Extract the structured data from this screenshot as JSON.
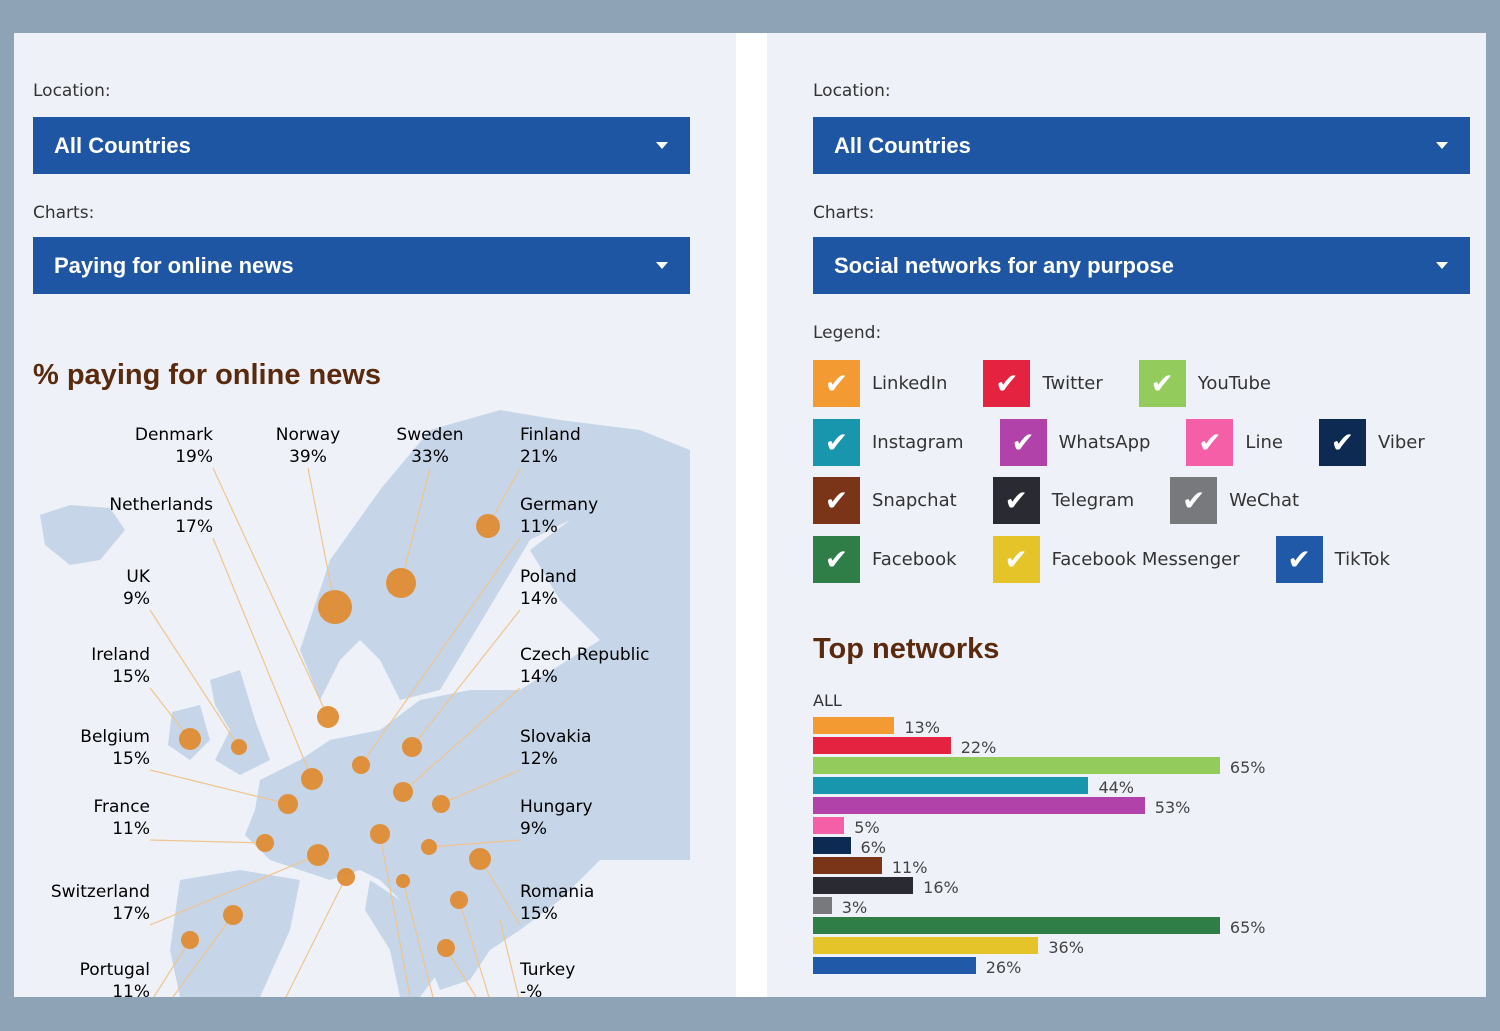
{
  "left": {
    "location_label": "Location:",
    "location_value": "All Countries",
    "charts_label": "Charts:",
    "charts_value": "Paying for online news",
    "title": "% paying for online news",
    "countries": [
      {
        "name": "Denmark",
        "value": "19%"
      },
      {
        "name": "Norway",
        "value": "39%"
      },
      {
        "name": "Sweden",
        "value": "33%"
      },
      {
        "name": "Finland",
        "value": "21%"
      },
      {
        "name": "Netherlands",
        "value": "17%"
      },
      {
        "name": "Germany",
        "value": "11%"
      },
      {
        "name": "UK",
        "value": "9%"
      },
      {
        "name": "Poland",
        "value": "14%"
      },
      {
        "name": "Ireland",
        "value": "15%"
      },
      {
        "name": "Czech Republic",
        "value": "14%"
      },
      {
        "name": "Belgium",
        "value": "15%"
      },
      {
        "name": "Slovakia",
        "value": "12%"
      },
      {
        "name": "France",
        "value": "11%"
      },
      {
        "name": "Hungary",
        "value": "9%"
      },
      {
        "name": "Switzerland",
        "value": "17%"
      },
      {
        "name": "Romania",
        "value": "15%"
      },
      {
        "name": "Portugal",
        "value": "11%"
      },
      {
        "name": "Turkey",
        "value": "-%"
      }
    ],
    "marker_color": "#e08a2e",
    "map_color": "#c6d5e8"
  },
  "right": {
    "location_label": "Location:",
    "location_value": "All Countries",
    "charts_label": "Charts:",
    "charts_value": "Social networks for any purpose",
    "legend_label": "Legend:",
    "legend": [
      {
        "name": "LinkedIn",
        "color": "#f39a32",
        "checked": true
      },
      {
        "name": "Twitter",
        "color": "#e3233f",
        "checked": true
      },
      {
        "name": "YouTube",
        "color": "#94cb5d",
        "checked": true
      },
      {
        "name": "Instagram",
        "color": "#1796ad",
        "checked": true
      },
      {
        "name": "WhatsApp",
        "color": "#b042a9",
        "checked": true
      },
      {
        "name": "Line",
        "color": "#f45fa8",
        "checked": true
      },
      {
        "name": "Viber",
        "color": "#0d2a53",
        "checked": true
      },
      {
        "name": "Snapchat",
        "color": "#7a3519",
        "checked": true
      },
      {
        "name": "Telegram",
        "color": "#2a2a33",
        "checked": true
      },
      {
        "name": "WeChat",
        "color": "#78797d",
        "checked": true
      },
      {
        "name": "Facebook",
        "color": "#2f7d47",
        "checked": true
      },
      {
        "name": "Facebook Messenger",
        "color": "#e5c42a",
        "checked": true
      },
      {
        "name": "TikTok",
        "color": "#2059a8",
        "checked": true
      }
    ],
    "check_glyph": "✔"
  },
  "chart_data": {
    "type": "bar",
    "title": "Top networks",
    "group_label": "ALL",
    "orientation": "horizontal",
    "categories": [
      "LinkedIn",
      "Twitter",
      "YouTube",
      "Instagram",
      "WhatsApp",
      "Line",
      "Viber",
      "Snapchat",
      "Telegram",
      "WeChat",
      "Facebook",
      "Facebook Messenger",
      "TikTok"
    ],
    "values": [
      13,
      22,
      65,
      44,
      53,
      5,
      6,
      11,
      16,
      3,
      65,
      36,
      26
    ],
    "value_labels": [
      "13%",
      "22%",
      "65%",
      "44%",
      "53%",
      "5%",
      "6%",
      "11%",
      "16%",
      "3%",
      "65%",
      "36%",
      "26%"
    ],
    "unit": "%"
  }
}
